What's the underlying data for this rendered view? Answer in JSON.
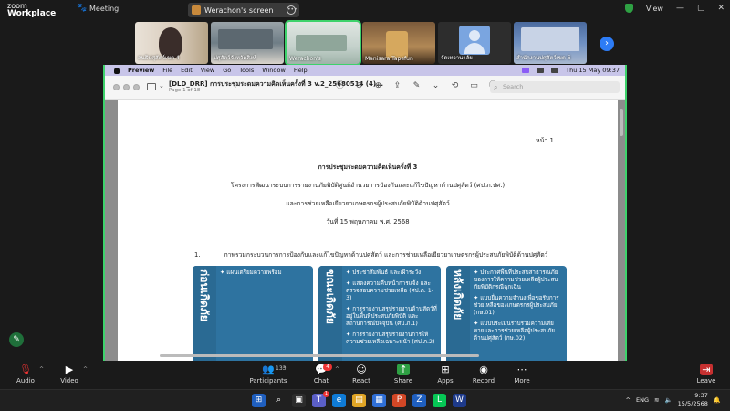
{
  "zoom": {
    "logo_line1": "zoom",
    "logo_line2": "Workplace",
    "meeting_label": "Meeting",
    "screen_pill_label": "Werachon's screen",
    "view_label": "View"
  },
  "participants": [
    {
      "name": "สนธิปศุสัตว์เขต 4"
    },
    {
      "name": "ปศุสัตว์จังหวัดสิงห์"
    },
    {
      "name": "Werachon's"
    },
    {
      "name": "Manisara Tapefun"
    },
    {
      "name": "จัดเทวานาลัย"
    },
    {
      "name": "สำนักงานปศุสัตว์เขต 6"
    }
  ],
  "mac_menu": {
    "app": "Preview",
    "items": [
      "File",
      "Edit",
      "View",
      "Go",
      "Tools",
      "Window",
      "Help"
    ],
    "clock": "Thu 15 May  09:37"
  },
  "preview": {
    "title": "[DLD_DRR] การประชุมระดมความคิดเห็นครั้งที่ 3 v.2_25680514 (4)...",
    "subtitle": "Page 1 of 18",
    "search_placeholder": "Search"
  },
  "document": {
    "page_number": "หน้า 1",
    "heading": "การประชุมระดมความคิดเห็นครั้งที่ 3",
    "line2": "โครงการพัฒนาระบบการรายงานภัยพิบัติศูนย์อำนวยการป้องกันและแก้ไขปัญหาด้านปศุสัตว์ (ศป.ภ.ปศ.)",
    "line3": "และการช่วยเหลือเยียวยาเกษตรกรผู้ประสบภัยพิบัติด้านปศุสัตว์",
    "date_line": "วันที่ 15 พฤษภาคม พ.ศ. 2568",
    "item1_number": "1.",
    "item1_text": "ภาพรวมกระบวนการการป้องกันและแก้ไขปัญหาด้านปศุสัตว์ และการช่วยเหลือเยียวยาเกษตรกรผู้ประสบภัยพิบัติด้านปศุสัตว์",
    "boxes": [
      {
        "label": "ก่อนเกิดภัย",
        "items": [
          "✦ แผนเตรียมความพร้อม"
        ]
      },
      {
        "label": "ขณะเกิดภัย",
        "items": [
          "✦ ประชาสัมพันธ์ และเฝ้าระวัง",
          "✦ แสดงความคืบหน้าการแจ้ง และตรวจสอบความช่วยเหลือ (ศป.ภ. 1-3)",
          "✦ การรายงานสรุปรายงานด้านสัตว์ที่อยู่ในพื้นที่ประสบภัยพิบัติ และสถานการณ์ปัจจุบัน (ศป.ภ.1)",
          "✦ การรายงานสรุปรายงานการให้ความช่วยเหลือเฉพาะหน้า (ศป.ภ.2)"
        ]
      },
      {
        "label": "หลังเกิดภัย",
        "items": [
          "✦ ประกาศพื้นที่ประสบสาธารณภัยของการให้ความช่วยเหลือผู้ประสบภัยพิบัติกรณีฉุกเฉิน",
          "✦ แบบยื่นความจำนงเพื่อขอรับการช่วยเหลือของเกษตรกรผู้ประสบภัย (กษ.01)",
          "✦ แบบประเมินรวบรวมความเสียหายและการช่วยเหลือผู้ประสบภัยด้านปศุสัตว์ (กษ.02)"
        ]
      }
    ]
  },
  "toolbar": {
    "audio": "Audio",
    "video": "Video",
    "participants": "Participants",
    "participants_count": "133",
    "chat": "Chat",
    "chat_badge": "4",
    "react": "React",
    "share": "Share",
    "apps": "Apps",
    "record": "Record",
    "more": "More",
    "leave": "Leave"
  },
  "taskbar": {
    "time": "9:37",
    "date": "15/5/2568",
    "lang": "ENG",
    "notif_badge": "1"
  }
}
